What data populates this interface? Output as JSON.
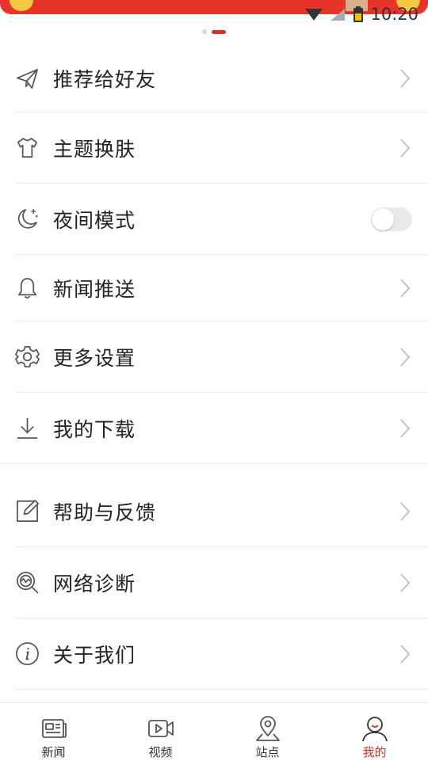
{
  "status_bar": {
    "time": "10:20"
  },
  "pager": {
    "count": 2,
    "active_index": 1
  },
  "menu": {
    "items": [
      {
        "key": "recommend",
        "label": "推荐给好友",
        "icon": "paper-plane-icon",
        "trailing": "chevron"
      },
      {
        "key": "theme",
        "label": "主题换肤",
        "icon": "tshirt-icon",
        "trailing": "chevron"
      },
      {
        "key": "night",
        "label": "夜间模式",
        "icon": "moon-icon",
        "trailing": "toggle",
        "toggle_on": false
      },
      {
        "key": "push",
        "label": "新闻推送",
        "icon": "bell-icon",
        "trailing": "chevron"
      },
      {
        "key": "settings",
        "label": "更多设置",
        "icon": "gear-icon",
        "trailing": "chevron"
      },
      {
        "key": "downloads",
        "label": "我的下载",
        "icon": "download-icon",
        "trailing": "chevron"
      },
      {
        "key": "feedback",
        "label": "帮助与反馈",
        "icon": "edit-icon",
        "trailing": "chevron"
      },
      {
        "key": "diagnose",
        "label": "网络诊断",
        "icon": "network-search-icon",
        "trailing": "chevron"
      },
      {
        "key": "about",
        "label": "关于我们",
        "icon": "info-icon",
        "trailing": "chevron"
      }
    ]
  },
  "bottom_nav": {
    "tabs": [
      {
        "label": "新闻",
        "icon": "news-icon",
        "active": false
      },
      {
        "label": "视频",
        "icon": "video-icon",
        "active": false
      },
      {
        "label": "站点",
        "icon": "location-pin-icon",
        "active": false
      },
      {
        "label": "我的",
        "icon": "user-icon",
        "active": true
      }
    ]
  },
  "colors": {
    "accent": "#d9322a",
    "banner": "#e8332a",
    "divider": "#ececec",
    "icon": "#555555",
    "chevron": "#bdbdbd"
  }
}
